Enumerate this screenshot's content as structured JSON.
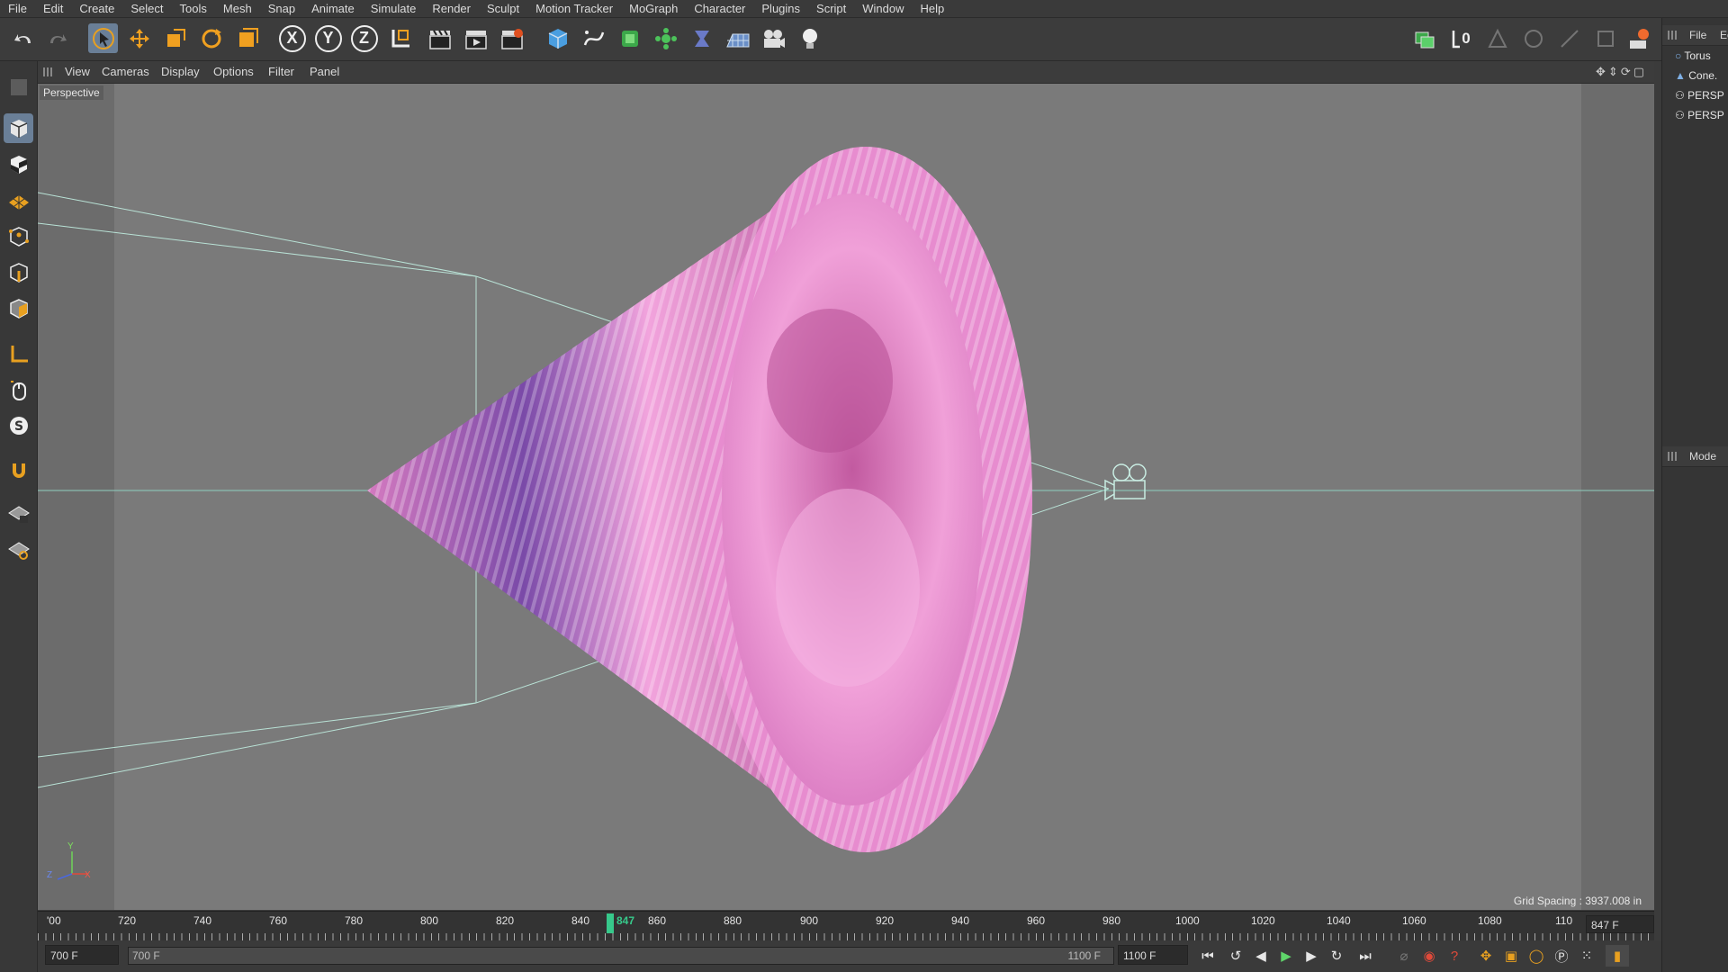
{
  "menu": [
    "File",
    "Edit",
    "Create",
    "Select",
    "Tools",
    "Mesh",
    "Snap",
    "Animate",
    "Simulate",
    "Render",
    "Sculpt",
    "Motion Tracker",
    "MoGraph",
    "Character",
    "Plugins",
    "Script",
    "Window",
    "Help"
  ],
  "toolbar": {
    "axis_x": "X",
    "axis_y": "Y",
    "axis_z": "Z",
    "layer_count": "0"
  },
  "viewport_menu": [
    "View",
    "Cameras",
    "Display",
    "Options",
    "Filter",
    "Panel"
  ],
  "viewport": {
    "label": "Perspective",
    "grid_spacing": "Grid Spacing : 3937.008 in",
    "axis_labels": {
      "y": "Y",
      "z": "Z",
      "x": "X"
    }
  },
  "object_manager": {
    "menu_file": "File",
    "menu_edit": "Ec",
    "objects": [
      "Torus",
      "Cone.",
      "PERSP",
      "PERSP"
    ]
  },
  "attribute_manager": {
    "mode": "Mode"
  },
  "timeline": {
    "ticks": [
      "'00",
      "720",
      "740",
      "760",
      "780",
      "800",
      "820",
      "840",
      "860",
      "880",
      "900",
      "920",
      "940",
      "960",
      "980",
      "1000",
      "1020",
      "1040",
      "1060",
      "1080",
      "110"
    ],
    "current_frame": "847",
    "current_frame_field": "847 F"
  },
  "transport": {
    "start_field": "700 F",
    "range_start": "700 F",
    "range_end": "1100 F",
    "end_field": "1100 F"
  },
  "colors": {
    "accent_blue": "#6a7f97",
    "cone_pink": "#e58fd4",
    "playhead": "#37c98b"
  }
}
